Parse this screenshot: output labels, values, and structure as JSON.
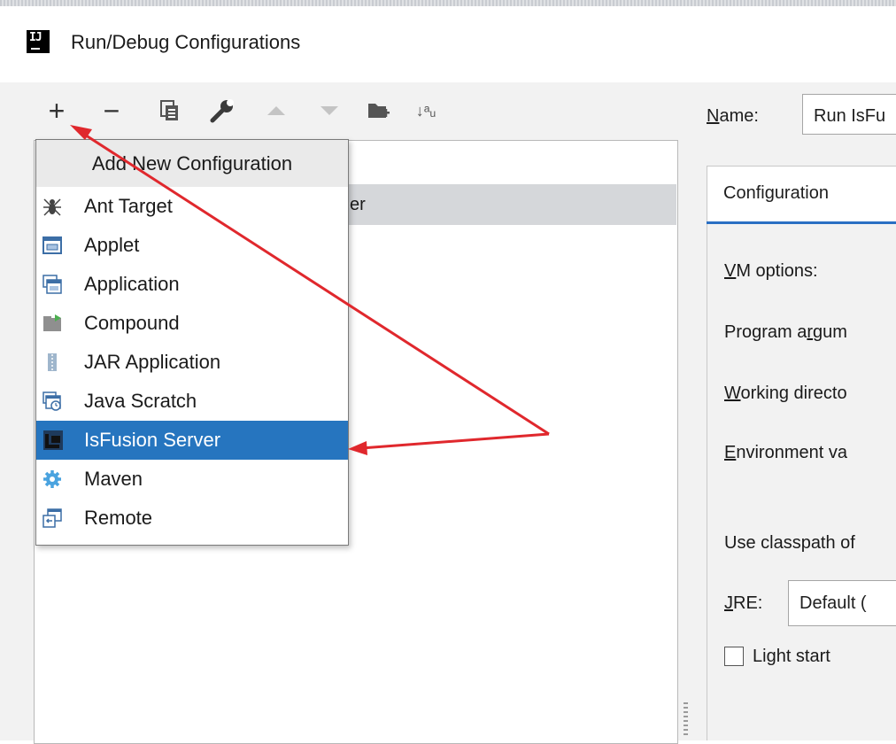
{
  "window": {
    "app_icon_text": "IJ",
    "title": "Run/Debug Configurations"
  },
  "toolbar": {
    "add_label": "+",
    "remove_label": "−",
    "sort_label": "↓ᵃᵤ"
  },
  "tree": {
    "selected_row_fragment": "er"
  },
  "popup": {
    "header": "Add New Configuration",
    "items": [
      {
        "label": "Ant Target",
        "icon": "ant-icon"
      },
      {
        "label": "Applet",
        "icon": "applet-icon"
      },
      {
        "label": "Application",
        "icon": "application-icon"
      },
      {
        "label": "Compound",
        "icon": "compound-icon"
      },
      {
        "label": "JAR Application",
        "icon": "jar-icon"
      },
      {
        "label": "Java Scratch",
        "icon": "java-scratch-icon"
      },
      {
        "label": "IsFusion Server",
        "icon": "isfusion-icon",
        "selected": true
      },
      {
        "label": "Maven",
        "icon": "maven-icon"
      },
      {
        "label": "Remote",
        "icon": "remote-icon"
      }
    ]
  },
  "config": {
    "name_label_u": "N",
    "name_label_rest": "ame:",
    "name_value": "Run IsFu",
    "tab_label": "Configuration",
    "vm_u": "V",
    "vm_rest": "M options:",
    "prog_pre": "Program a",
    "prog_u": "r",
    "prog_rest": "gum",
    "work_u": "W",
    "work_rest": "orking directo",
    "env_u": "E",
    "env_rest": "nvironment va",
    "classpath": "Use classpath of",
    "jre_u": "J",
    "jre_rest": "RE:",
    "jre_value": "Default (",
    "light_start": "Light start"
  },
  "colors": {
    "selection": "#2675bf",
    "annotation_arrow": "#e0282d",
    "tab_underline": "#2a6fc3"
  }
}
